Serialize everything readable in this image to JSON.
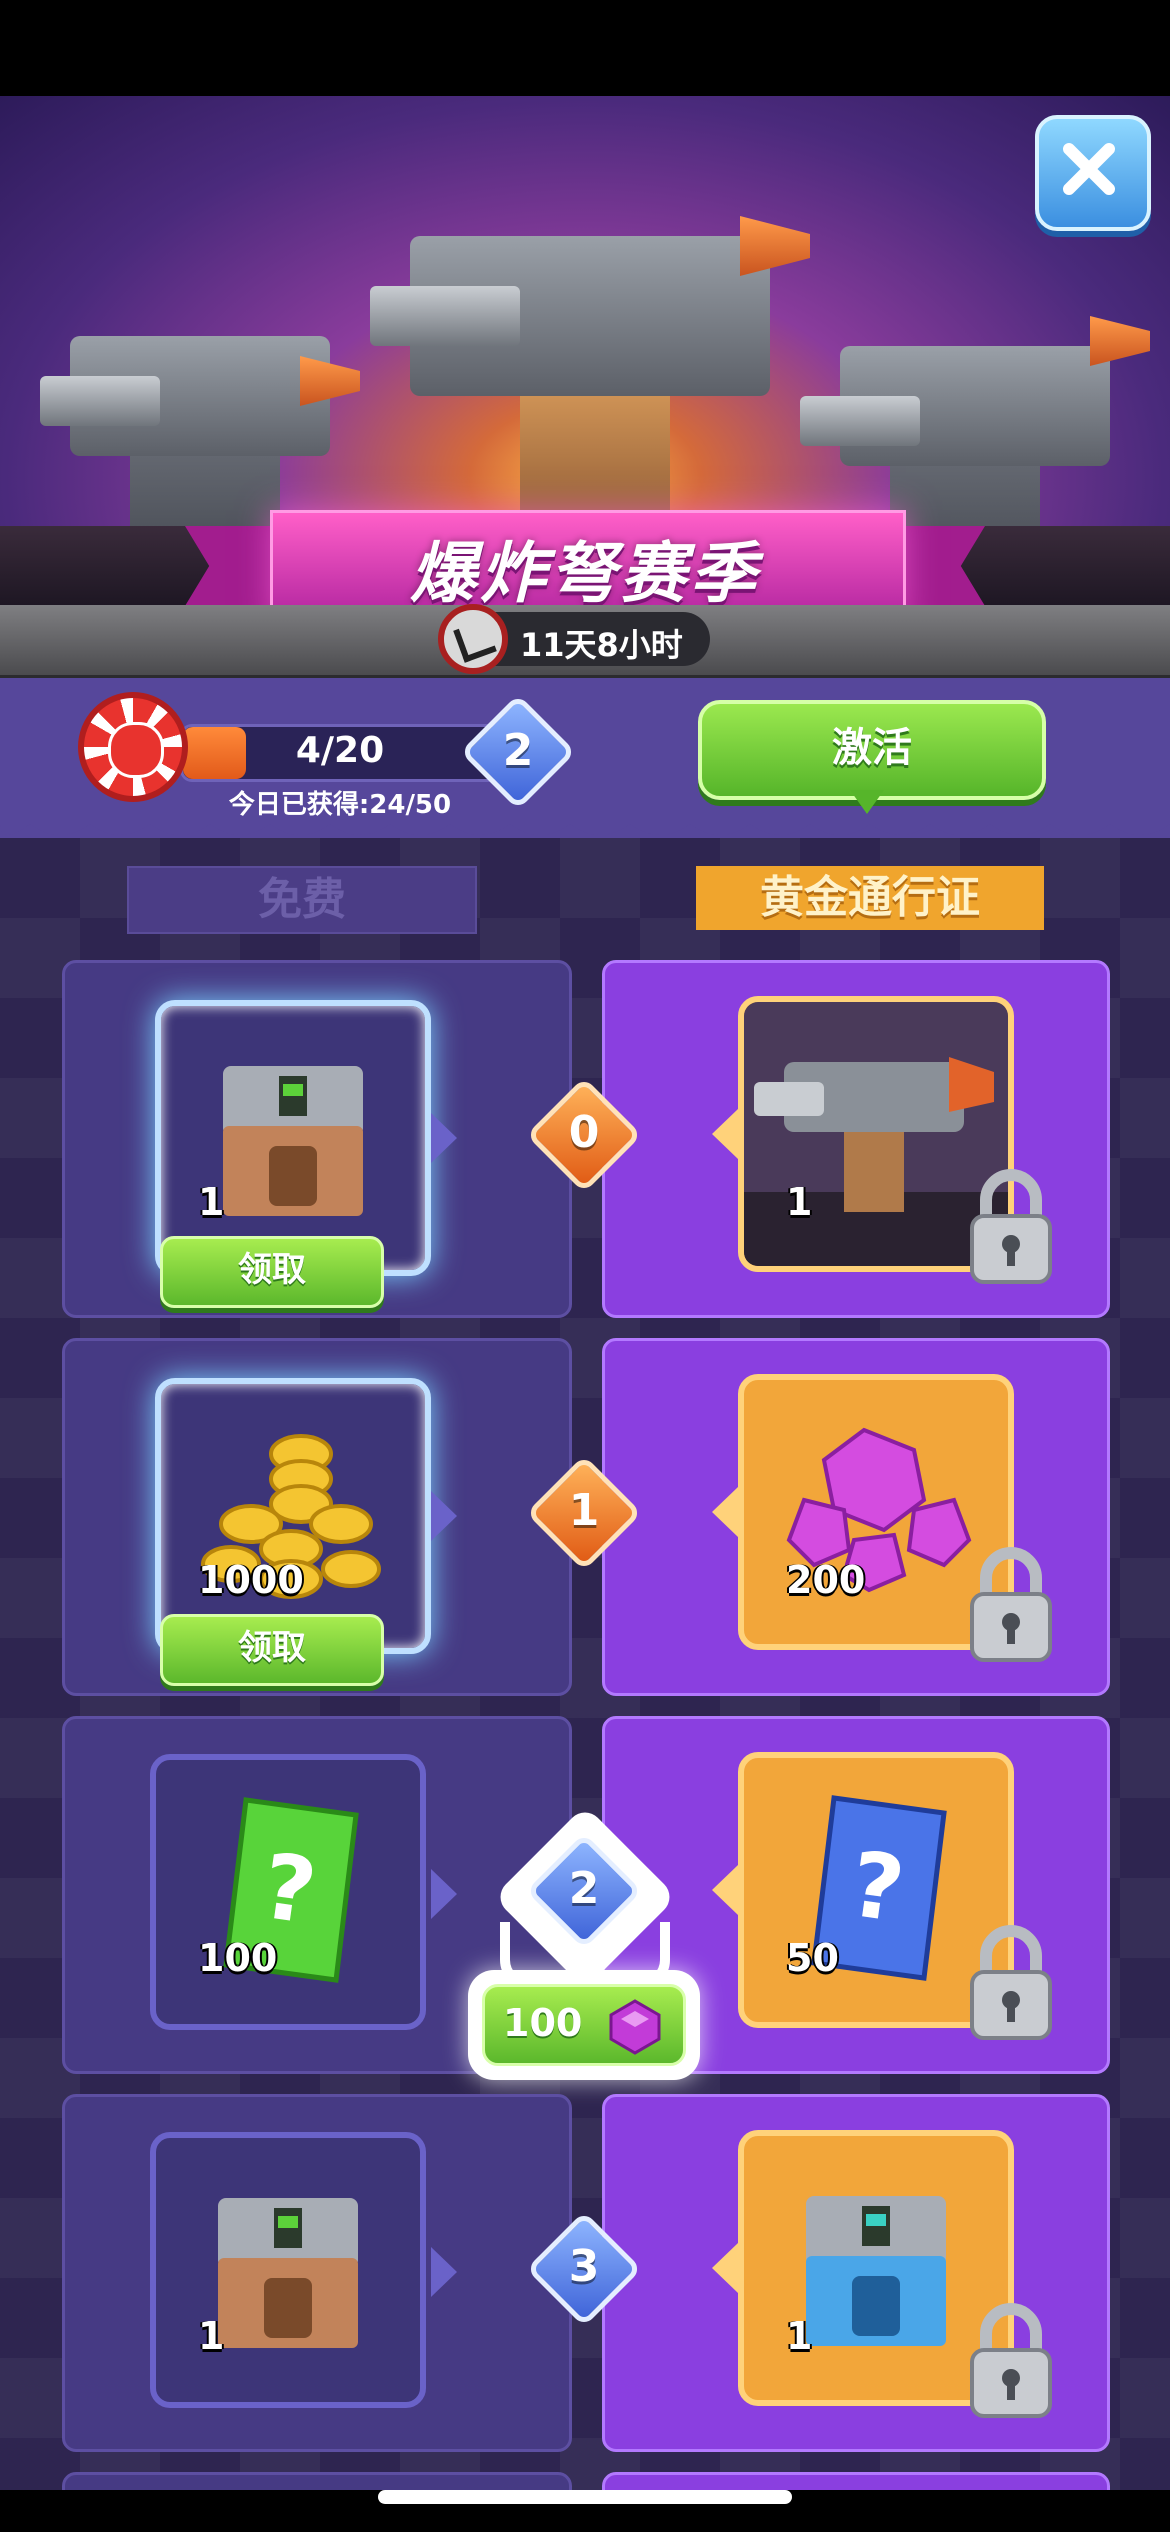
{
  "season": {
    "title": "爆炸弩赛季",
    "timer": "11天8小时"
  },
  "progress": {
    "label": "4/20",
    "current": 4,
    "max": 20,
    "today": "今日已获得:24/50",
    "level": "2"
  },
  "activate_label": "激活",
  "headers": {
    "free": "免费",
    "gold": "黄金通行证"
  },
  "rows": [
    {
      "level": "0",
      "level_color": "orange",
      "free": {
        "qty": "1",
        "icon": "iron-chest-icon",
        "claimable": true,
        "claim_label": "领取"
      },
      "gold": {
        "qty": "1",
        "icon": "crossbow-turret-icon",
        "locked": true
      }
    },
    {
      "level": "1",
      "level_color": "orange",
      "free": {
        "qty": "1000",
        "icon": "gold-coins-icon",
        "claimable": true,
        "claim_label": "领取"
      },
      "gold": {
        "qty": "200",
        "icon": "purple-gems-icon",
        "locked": true
      }
    },
    {
      "level": "2",
      "level_color": "blue",
      "free": {
        "qty": "100",
        "icon": "green-mystery-card-icon",
        "claimable": false
      },
      "gold": {
        "qty": "50",
        "icon": "blue-mystery-card-icon",
        "locked": true
      }
    },
    {
      "level": "3",
      "level_color": "blue",
      "free": {
        "qty": "1",
        "icon": "iron-chest-icon",
        "claimable": false
      },
      "gold": {
        "qty": "1",
        "icon": "blue-chest-icon",
        "locked": true
      }
    }
  ],
  "buy_level": {
    "price": "100",
    "currency_icon": "purple-gem-icon"
  },
  "colors": {
    "accent_green": "#5cb82c",
    "gold_pass": "#f0a52d",
    "purple_panel": "#8a3fe0",
    "free_panel": "#463a84"
  }
}
